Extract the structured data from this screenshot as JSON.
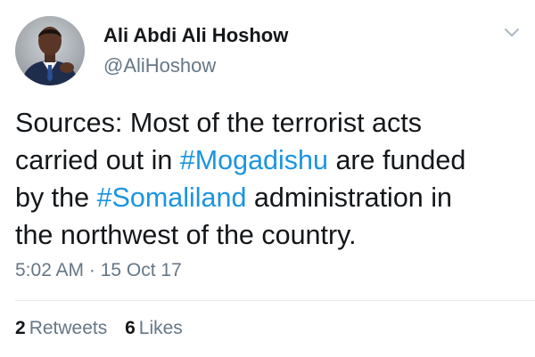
{
  "author": {
    "display_name": "Ali Abdi Ali Hoshow",
    "handle": "@AliHoshow",
    "avatar_icon": "profile-photo"
  },
  "menu_icon": "chevron-down-icon",
  "tweet": {
    "line1": "Sources: Most of the terrorist acts",
    "line2_pre": "carried out in ",
    "hashtag1": "#Mogadishu",
    "line2_post": " are funded",
    "line3_pre": "by the ",
    "hashtag2": "#Somaliland",
    "line3_post": " administration in",
    "line4": "the northwest of the country."
  },
  "timestamp": "5:02 AM · 15 Oct 17",
  "stats": {
    "retweets_count": "2",
    "retweets_label": "Retweets",
    "likes_count": "6",
    "likes_label": "Likes"
  },
  "colors": {
    "text": "#14171a",
    "secondary": "#657786",
    "link": "#1b95e0",
    "divider": "#e1e8ed"
  }
}
